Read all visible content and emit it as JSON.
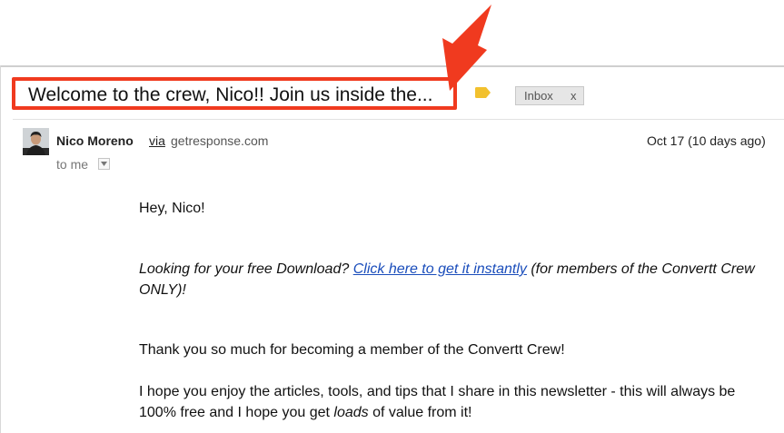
{
  "subject": {
    "text": "Welcome to the crew, Nico!! Join us inside the..."
  },
  "labels": {
    "inbox": "Inbox",
    "remove": "x"
  },
  "sender": {
    "name": "Nico Moreno",
    "via": "via",
    "domain": "getresponse.com",
    "date": "Oct 17 (10 days ago)",
    "recipient": "to me"
  },
  "body": {
    "greeting": "Hey, Nico!",
    "offer_before": "Looking for your free Download? ",
    "offer_link": "Click here to get it instantly",
    "offer_after": " (for members of the Convertt Crew ONLY)!",
    "thanks": "Thank you so much for becoming a member of the Convertt Crew!",
    "hope_before": "I hope you enjoy the articles, tools, and tips that I share in this newsletter - this will always be 100% free and I hope you get ",
    "hope_em": "loads",
    "hope_after": " of value from it!"
  },
  "colors": {
    "highlight": "#f03a1f",
    "link": "#1a4dbb",
    "label_tag": "#f2c12e"
  }
}
